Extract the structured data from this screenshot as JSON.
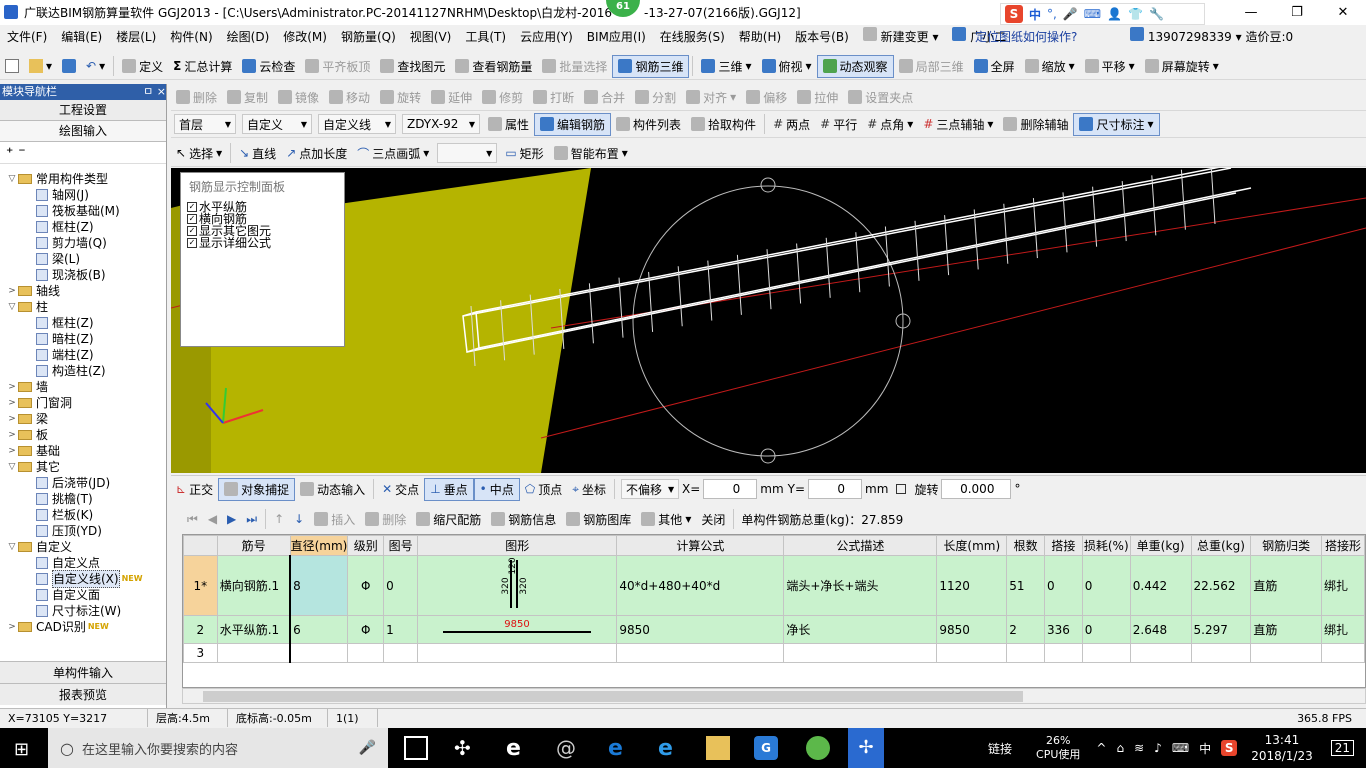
{
  "window": {
    "title": "广联达BIM钢筋算量软件 GGJ2013 - [C:\\Users\\Administrator.PC-20141127NRHM\\Desktop\\白龙村-2016",
    "title_suffix": "-13-27-07(2166版).GGJ12]",
    "badge": "61",
    "minimize": "—",
    "maximize": "❐",
    "close": "✕"
  },
  "ime": {
    "logo": "S",
    "lang": "中",
    "dot": "°,"
  },
  "menu": {
    "items": [
      "文件(F)",
      "编辑(E)",
      "楼层(L)",
      "构件(N)",
      "绘图(D)",
      "修改(M)",
      "钢筋量(Q)",
      "视图(V)",
      "工具(T)",
      "云应用(Y)",
      "BIM应用(I)",
      "在线服务(S)",
      "帮助(H)",
      "版本号(B)",
      "新建变更",
      "广小二"
    ],
    "help_link": "定位图纸如何操作?",
    "phone": "13907298339",
    "cost_bean": "造价豆:0"
  },
  "toolbar1": {
    "items": [
      "定义",
      "汇总计算",
      "云检查",
      "平齐板顶",
      "查找图元",
      "查看钢筋量",
      "批量选择",
      "钢筋三维",
      "三维",
      "俯视",
      "动态观察",
      "局部三维",
      "全屏",
      "缩放",
      "平移",
      "屏幕旋转"
    ]
  },
  "toolbar2": {
    "items": [
      "删除",
      "复制",
      "镜像",
      "移动",
      "旋转",
      "延伸",
      "修剪",
      "打断",
      "合并",
      "分割",
      "对齐",
      "偏移",
      "拉伸",
      "设置夹点"
    ]
  },
  "toolbar3": {
    "floor": "首层",
    "type": "自定义",
    "subtype": "自定义线",
    "name": "ZDYX-92",
    "items": [
      "属性",
      "编辑钢筋",
      "构件列表",
      "拾取构件",
      "两点",
      "平行",
      "点角",
      "三点辅轴",
      "删除辅轴",
      "尺寸标注"
    ]
  },
  "toolbar4": {
    "items": [
      "选择",
      "直线",
      "点加长度",
      "三点画弧",
      "矩形",
      "智能布置"
    ]
  },
  "left_panel": {
    "title": "模块导航栏",
    "pin": "ㅁ ×",
    "tabs": [
      "工程设置",
      "绘图输入"
    ],
    "tools": "⁺ ⁻",
    "tree": [
      {
        "label": "常用构件类型",
        "level": 0,
        "folder": true,
        "exp": "▽"
      },
      {
        "label": "轴网(J)",
        "level": 1
      },
      {
        "label": "筏板基础(M)",
        "level": 1
      },
      {
        "label": "框柱(Z)",
        "level": 1
      },
      {
        "label": "剪力墙(Q)",
        "level": 1
      },
      {
        "label": "梁(L)",
        "level": 1
      },
      {
        "label": "现浇板(B)",
        "level": 1
      },
      {
        "label": "轴线",
        "level": 0,
        "folder": true,
        "exp": ">"
      },
      {
        "label": "柱",
        "level": 0,
        "folder": true,
        "exp": "▽"
      },
      {
        "label": "框柱(Z)",
        "level": 1
      },
      {
        "label": "暗柱(Z)",
        "level": 1
      },
      {
        "label": "端柱(Z)",
        "level": 1
      },
      {
        "label": "构造柱(Z)",
        "level": 1
      },
      {
        "label": "墙",
        "level": 0,
        "folder": true,
        "exp": ">"
      },
      {
        "label": "门窗洞",
        "level": 0,
        "folder": true,
        "exp": ">"
      },
      {
        "label": "梁",
        "level": 0,
        "folder": true,
        "exp": ">"
      },
      {
        "label": "板",
        "level": 0,
        "folder": true,
        "exp": ">"
      },
      {
        "label": "基础",
        "level": 0,
        "folder": true,
        "exp": ">"
      },
      {
        "label": "其它",
        "level": 0,
        "folder": true,
        "exp": "▽"
      },
      {
        "label": "后浇带(JD)",
        "level": 1
      },
      {
        "label": "挑檐(T)",
        "level": 1
      },
      {
        "label": "栏板(K)",
        "level": 1
      },
      {
        "label": "压顶(YD)",
        "level": 1
      },
      {
        "label": "自定义",
        "level": 0,
        "folder": true,
        "exp": "▽"
      },
      {
        "label": "自定义点",
        "level": 1
      },
      {
        "label": "自定义线(X)",
        "level": 1,
        "new": "NEW"
      },
      {
        "label": "自定义面",
        "level": 1
      },
      {
        "label": "尺寸标注(W)",
        "level": 1
      },
      {
        "label": "CAD识别",
        "level": 0,
        "folder": true,
        "exp": ">",
        "new": "NEW"
      }
    ],
    "bottom_tabs": [
      "单构件输入",
      "报表预览"
    ]
  },
  "control_panel": {
    "title": "钢筋显示控制面板",
    "options": [
      "水平纵筋",
      "横向钢筋",
      "显示其它图元",
      "显示详细公式"
    ],
    "checked": "✓"
  },
  "snapbar": {
    "items": [
      "正交",
      "对象捕捉",
      "动态输入",
      "交点",
      "垂点",
      "中点",
      "顶点",
      "坐标"
    ],
    "offset_mode": "不偏移",
    "x_label": "X=",
    "x_value": "0",
    "unit": "mm",
    "y_label": "Y=",
    "y_value": "0",
    "rotate_label": "旋转",
    "rotate_value": "0.000",
    "degree": "°"
  },
  "rebar_toolbar": {
    "items": [
      "插入",
      "删除",
      "缩尺配筋",
      "钢筋信息",
      "钢筋图库",
      "其他",
      "关闭"
    ],
    "total_label": "单构件钢筋总重(kg)：27.859"
  },
  "grid": {
    "headers": [
      "筋号",
      "直径(mm)",
      "级别",
      "图号",
      "图形",
      "计算公式",
      "公式描述",
      "长度(mm)",
      "根数",
      "搭接",
      "损耗(%)",
      "单重(kg)",
      "总重(kg)",
      "钢筋归类",
      "搭接形"
    ],
    "rows": [
      {
        "no": "1*",
        "name": "横向钢筋.1",
        "dia": "8",
        "grade": "Φ",
        "fig": "0",
        "shape_labels": [
          "320",
          "320",
          "120"
        ],
        "formula": "40*d+480+40*d",
        "desc": "端头+净长+端头",
        "length": "1120",
        "count": "51",
        "lap": "0",
        "loss": "0",
        "unit_w": "0.442",
        "total_w": "22.562",
        "category": "直筋",
        "lap_type": "绑扎"
      },
      {
        "no": "2",
        "name": "水平纵筋.1",
        "dia": "6",
        "grade": "Φ",
        "fig": "1",
        "shape_labels": [
          "9850"
        ],
        "formula": "9850",
        "desc": "净长",
        "length": "9850",
        "count": "2",
        "lap": "336",
        "loss": "0",
        "unit_w": "2.648",
        "total_w": "5.297",
        "category": "直筋",
        "lap_type": "绑扎"
      },
      {
        "no": "3",
        "name": "",
        "dia": "",
        "grade": "",
        "fig": "",
        "shape_labels": [],
        "formula": "",
        "desc": "",
        "length": "",
        "count": "",
        "lap": "",
        "loss": "",
        "unit_w": "",
        "total_w": "",
        "category": "",
        "lap_type": ""
      }
    ]
  },
  "status": {
    "coords": "X=73105 Y=3217",
    "floor_height": "层高:4.5m",
    "bottom_height": "底标高:-0.05m",
    "count": "1(1)",
    "fps": "365.8 FPS"
  },
  "taskbar": {
    "search_placeholder": "在这里输入你要搜索的内容",
    "link": "链接",
    "cpu": "26%",
    "cpu_label": "CPU使用",
    "lang": "中",
    "time": "13:41",
    "date": "2018/1/23",
    "notif": "21"
  },
  "colors": {
    "accent": "#2f5fa8",
    "grid_row": "#c9f2cd",
    "header_hl": "#f6d39b",
    "viewport_bg": "#000000",
    "wall_yellow": "#b5b400"
  }
}
